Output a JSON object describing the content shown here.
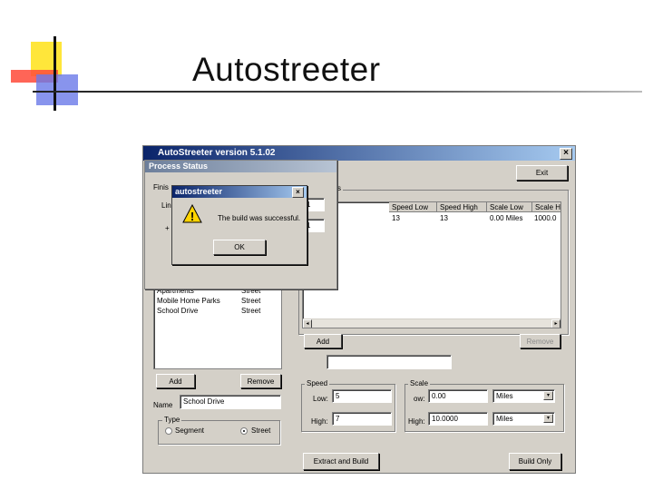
{
  "slide": {
    "title": "Autostreeter"
  },
  "window": {
    "title": "AutoStreeter version 5.1.02",
    "close_glyph": "×",
    "exit_label": "Exit",
    "top_group_label": "s",
    "table": {
      "columns": [
        "Speed Low",
        "Speed High",
        "Scale Low",
        "Scale H"
      ],
      "rows": [
        [
          "13",
          "13",
          "0.00 Miles",
          "1000.0"
        ]
      ]
    },
    "right_add_label": "Add",
    "right_remove_label": "Remove",
    "name_top_value": "",
    "speed_group": {
      "label": "Speed",
      "low_label": "Low:",
      "low_value": "5",
      "high_label": "High:",
      "high_value": "7"
    },
    "scale_group": {
      "label": "Scale",
      "low_label": "ow:",
      "low_value": "0.00",
      "low_unit": "Miles",
      "high_label": "High:",
      "high_value": "10.0000",
      "high_unit": "Miles"
    },
    "left_list": {
      "items": [
        {
          "name": "Apartments",
          "type": "Street"
        },
        {
          "name": "Mobile Home Parks",
          "type": "Street"
        },
        {
          "name": "School Drive",
          "type": "Street"
        }
      ]
    },
    "left_add_label": "Add",
    "left_remove_label": "Remove",
    "name_label": "Name",
    "name_value": "School Drive",
    "type_group": {
      "label": "Type",
      "segment_label": "Segment",
      "street_label": "Street",
      "selected": "Street"
    },
    "extract_build_label": "Extract and Build",
    "build_only_label": "Build Only"
  },
  "process_status": {
    "title": "Process Status",
    "finish_label": "Finis",
    "line_label": "Lin",
    "plus_label": "+",
    "field1_value": "1",
    "field2_value": "1"
  },
  "message_box": {
    "title": "autostreeter",
    "close_glyph": "×",
    "text": "The build was successful.",
    "ok_label": "OK",
    "icon_glyph": "!"
  },
  "scroll": {
    "left_glyph": "◂",
    "right_glyph": "▸",
    "down_glyph": "▾"
  },
  "colors": {
    "titlebar": "#0a246a",
    "face": "#d4d0c8",
    "warning": "#ffd400"
  }
}
